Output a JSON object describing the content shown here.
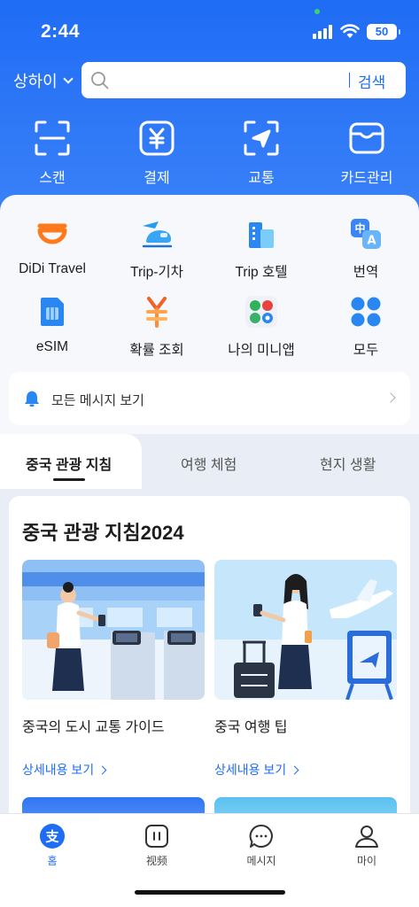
{
  "status_bar": {
    "time": "2:44",
    "battery": "50"
  },
  "header": {
    "city": "상하이",
    "search": {
      "placeholder": "",
      "button": "검색"
    }
  },
  "quick_actions": [
    {
      "label": "스캔",
      "icon": "scan-icon"
    },
    {
      "label": "결제",
      "icon": "yuan-payment-icon"
    },
    {
      "label": "교통",
      "icon": "transport-icon"
    },
    {
      "label": "카드관리",
      "icon": "card-wallet-icon"
    }
  ],
  "services": [
    {
      "label": "DiDi Travel",
      "icon": "didi-icon"
    },
    {
      "label": "Trip-기차",
      "icon": "train-icon"
    },
    {
      "label": "Trip 호텔",
      "icon": "hotel-icon"
    },
    {
      "label": "번역",
      "icon": "translate-icon"
    },
    {
      "label": "eSIM",
      "icon": "esim-icon"
    },
    {
      "label": "확률 조회",
      "icon": "exchange-rate-icon"
    },
    {
      "label": "나의 미니앱",
      "icon": "mini-apps-icon"
    },
    {
      "label": "모두",
      "icon": "all-icon"
    }
  ],
  "message_bar": {
    "text": "모든 메시지 보기"
  },
  "tabs": [
    {
      "label": "중국 관광 지침",
      "active": true
    },
    {
      "label": "여행 체험",
      "active": false
    },
    {
      "label": "현지 생활",
      "active": false
    }
  ],
  "guide": {
    "title": "중국 관광 지침2024",
    "cards": [
      {
        "title": "중국의 도시 교통 가이드",
        "link": "상세내용 보기"
      },
      {
        "title": "중국 여행 팁",
        "link": "상세내용 보기"
      }
    ]
  },
  "bottom_nav": [
    {
      "label": "홈",
      "icon": "home-alipay-icon",
      "active": true
    },
    {
      "label": "视频",
      "icon": "video-icon",
      "active": false
    },
    {
      "label": "메시지",
      "icon": "message-icon",
      "active": false
    },
    {
      "label": "마이",
      "icon": "profile-icon",
      "active": false
    }
  ],
  "colors": {
    "primary": "#1f6cf5",
    "background": "#f3f5f9"
  }
}
